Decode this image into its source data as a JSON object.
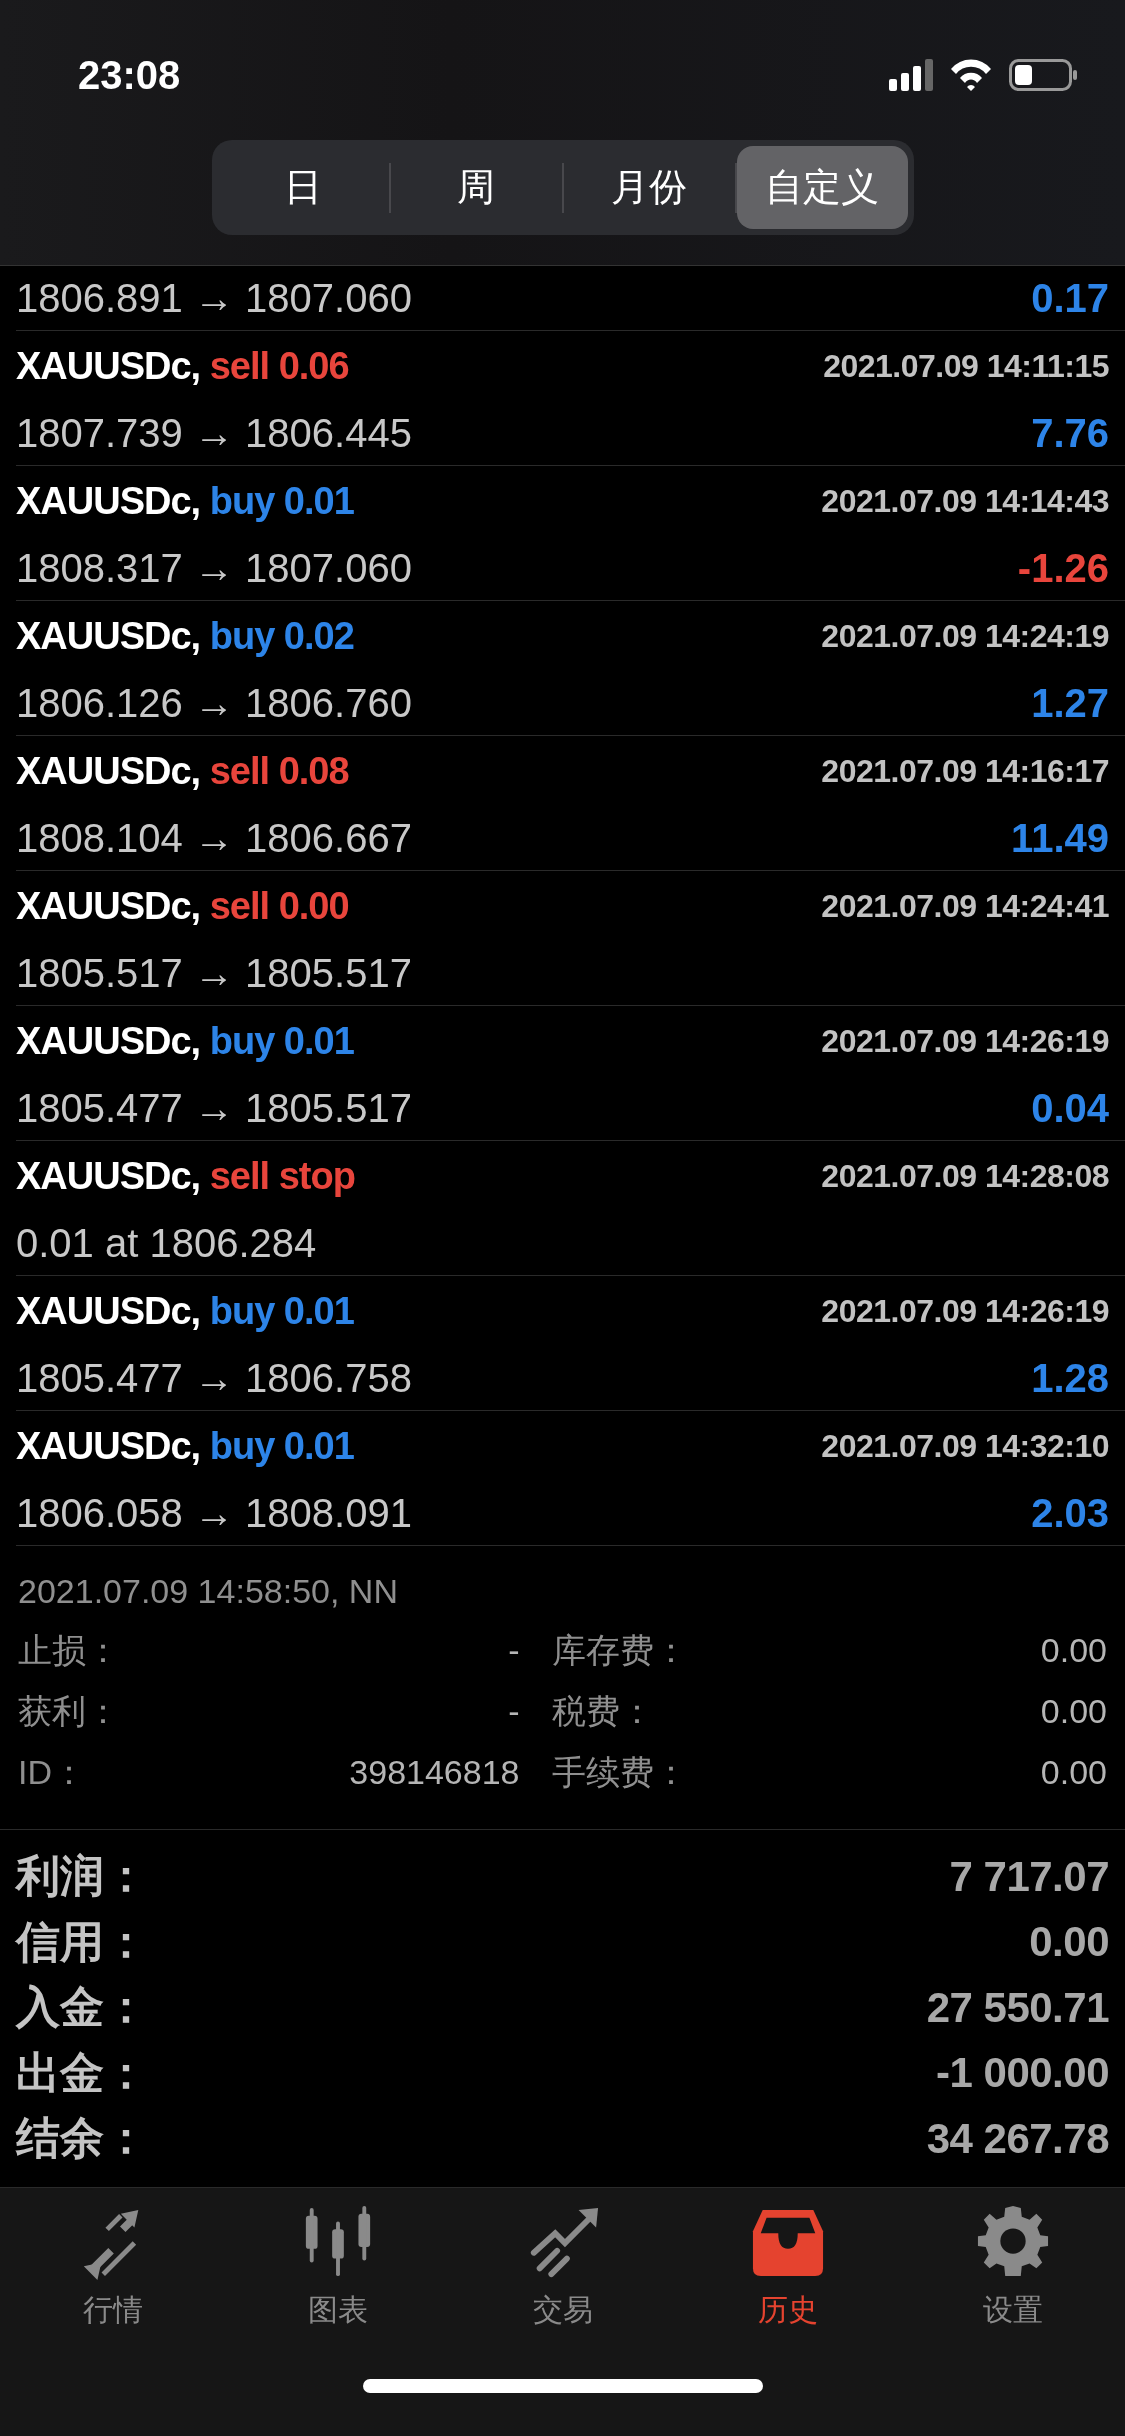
{
  "status_bar": {
    "time": "23:08"
  },
  "segments": [
    {
      "label": "日",
      "selected": false
    },
    {
      "label": "周",
      "selected": false
    },
    {
      "label": "月份",
      "selected": false
    },
    {
      "label": "自定义",
      "selected": true
    }
  ],
  "first_row": {
    "price": "1806.891 → 1807.060",
    "profit": "0.17",
    "loss": false
  },
  "trades": [
    {
      "symbol": "XAUUSDc,",
      "kind": "sell",
      "order": "sell 0.06",
      "time": "2021.07.09 14:11:15",
      "price": "1807.739 → 1806.445",
      "profit": "7.76",
      "loss": false
    },
    {
      "symbol": "XAUUSDc,",
      "kind": "buy",
      "order": "buy 0.01",
      "time": "2021.07.09 14:14:43",
      "price": "1808.317 → 1807.060",
      "profit": "-1.26",
      "loss": true
    },
    {
      "symbol": "XAUUSDc,",
      "kind": "buy",
      "order": "buy 0.02",
      "time": "2021.07.09 14:24:19",
      "price": "1806.126 → 1806.760",
      "profit": "1.27",
      "loss": false
    },
    {
      "symbol": "XAUUSDc,",
      "kind": "sell",
      "order": "sell 0.08",
      "time": "2021.07.09 14:16:17",
      "price": "1808.104 → 1806.667",
      "profit": "11.49",
      "loss": false
    },
    {
      "symbol": "XAUUSDc,",
      "kind": "sell",
      "order": "sell 0.00",
      "time": "2021.07.09 14:24:41",
      "price": "1805.517 → 1805.517"
    },
    {
      "symbol": "XAUUSDc,",
      "kind": "buy",
      "order": "buy 0.01",
      "time": "2021.07.09 14:26:19",
      "price": "1805.477 → 1805.517",
      "profit": "0.04",
      "loss": false
    },
    {
      "symbol": "XAUUSDc,",
      "kind": "sell",
      "order": "sell stop",
      "time": "2021.07.09 14:28:08",
      "price": "0.01 at 1806.284"
    },
    {
      "symbol": "XAUUSDc,",
      "kind": "buy",
      "order": "buy 0.01",
      "time": "2021.07.09 14:26:19",
      "price": "1805.477 → 1806.758",
      "profit": "1.28",
      "loss": false
    },
    {
      "symbol": "XAUUSDc,",
      "kind": "buy",
      "order": "buy 0.01",
      "time": "2021.07.09 14:32:10",
      "price": "1806.058 → 1808.091",
      "profit": "2.03",
      "loss": false
    }
  ],
  "details": {
    "timestamp": "2021.07.09 14:58:50, NN",
    "fields": [
      {
        "label": "止损：",
        "value": "-"
      },
      {
        "label": "库存费：",
        "value": "0.00"
      },
      {
        "label": "获利：",
        "value": "-"
      },
      {
        "label": "税费：",
        "value": "0.00"
      },
      {
        "label": "ID：",
        "value": "398146818"
      },
      {
        "label": "手续费：",
        "value": "0.00"
      }
    ]
  },
  "summary": [
    {
      "label": "利润：",
      "value": "7 717.07"
    },
    {
      "label": "信用：",
      "value": "0.00"
    },
    {
      "label": "入金：",
      "value": "27 550.71"
    },
    {
      "label": "出金：",
      "value": "-1 000.00"
    },
    {
      "label": "结余：",
      "value": "34 267.78"
    }
  ],
  "tabs": [
    {
      "label": "行情",
      "kind": "quotes",
      "selected": false
    },
    {
      "label": "图表",
      "kind": "chart",
      "selected": false
    },
    {
      "label": "交易",
      "kind": "trade",
      "selected": false
    },
    {
      "label": "历史",
      "kind": "history",
      "selected": true
    },
    {
      "label": "设置",
      "kind": "settings",
      "selected": false
    }
  ]
}
